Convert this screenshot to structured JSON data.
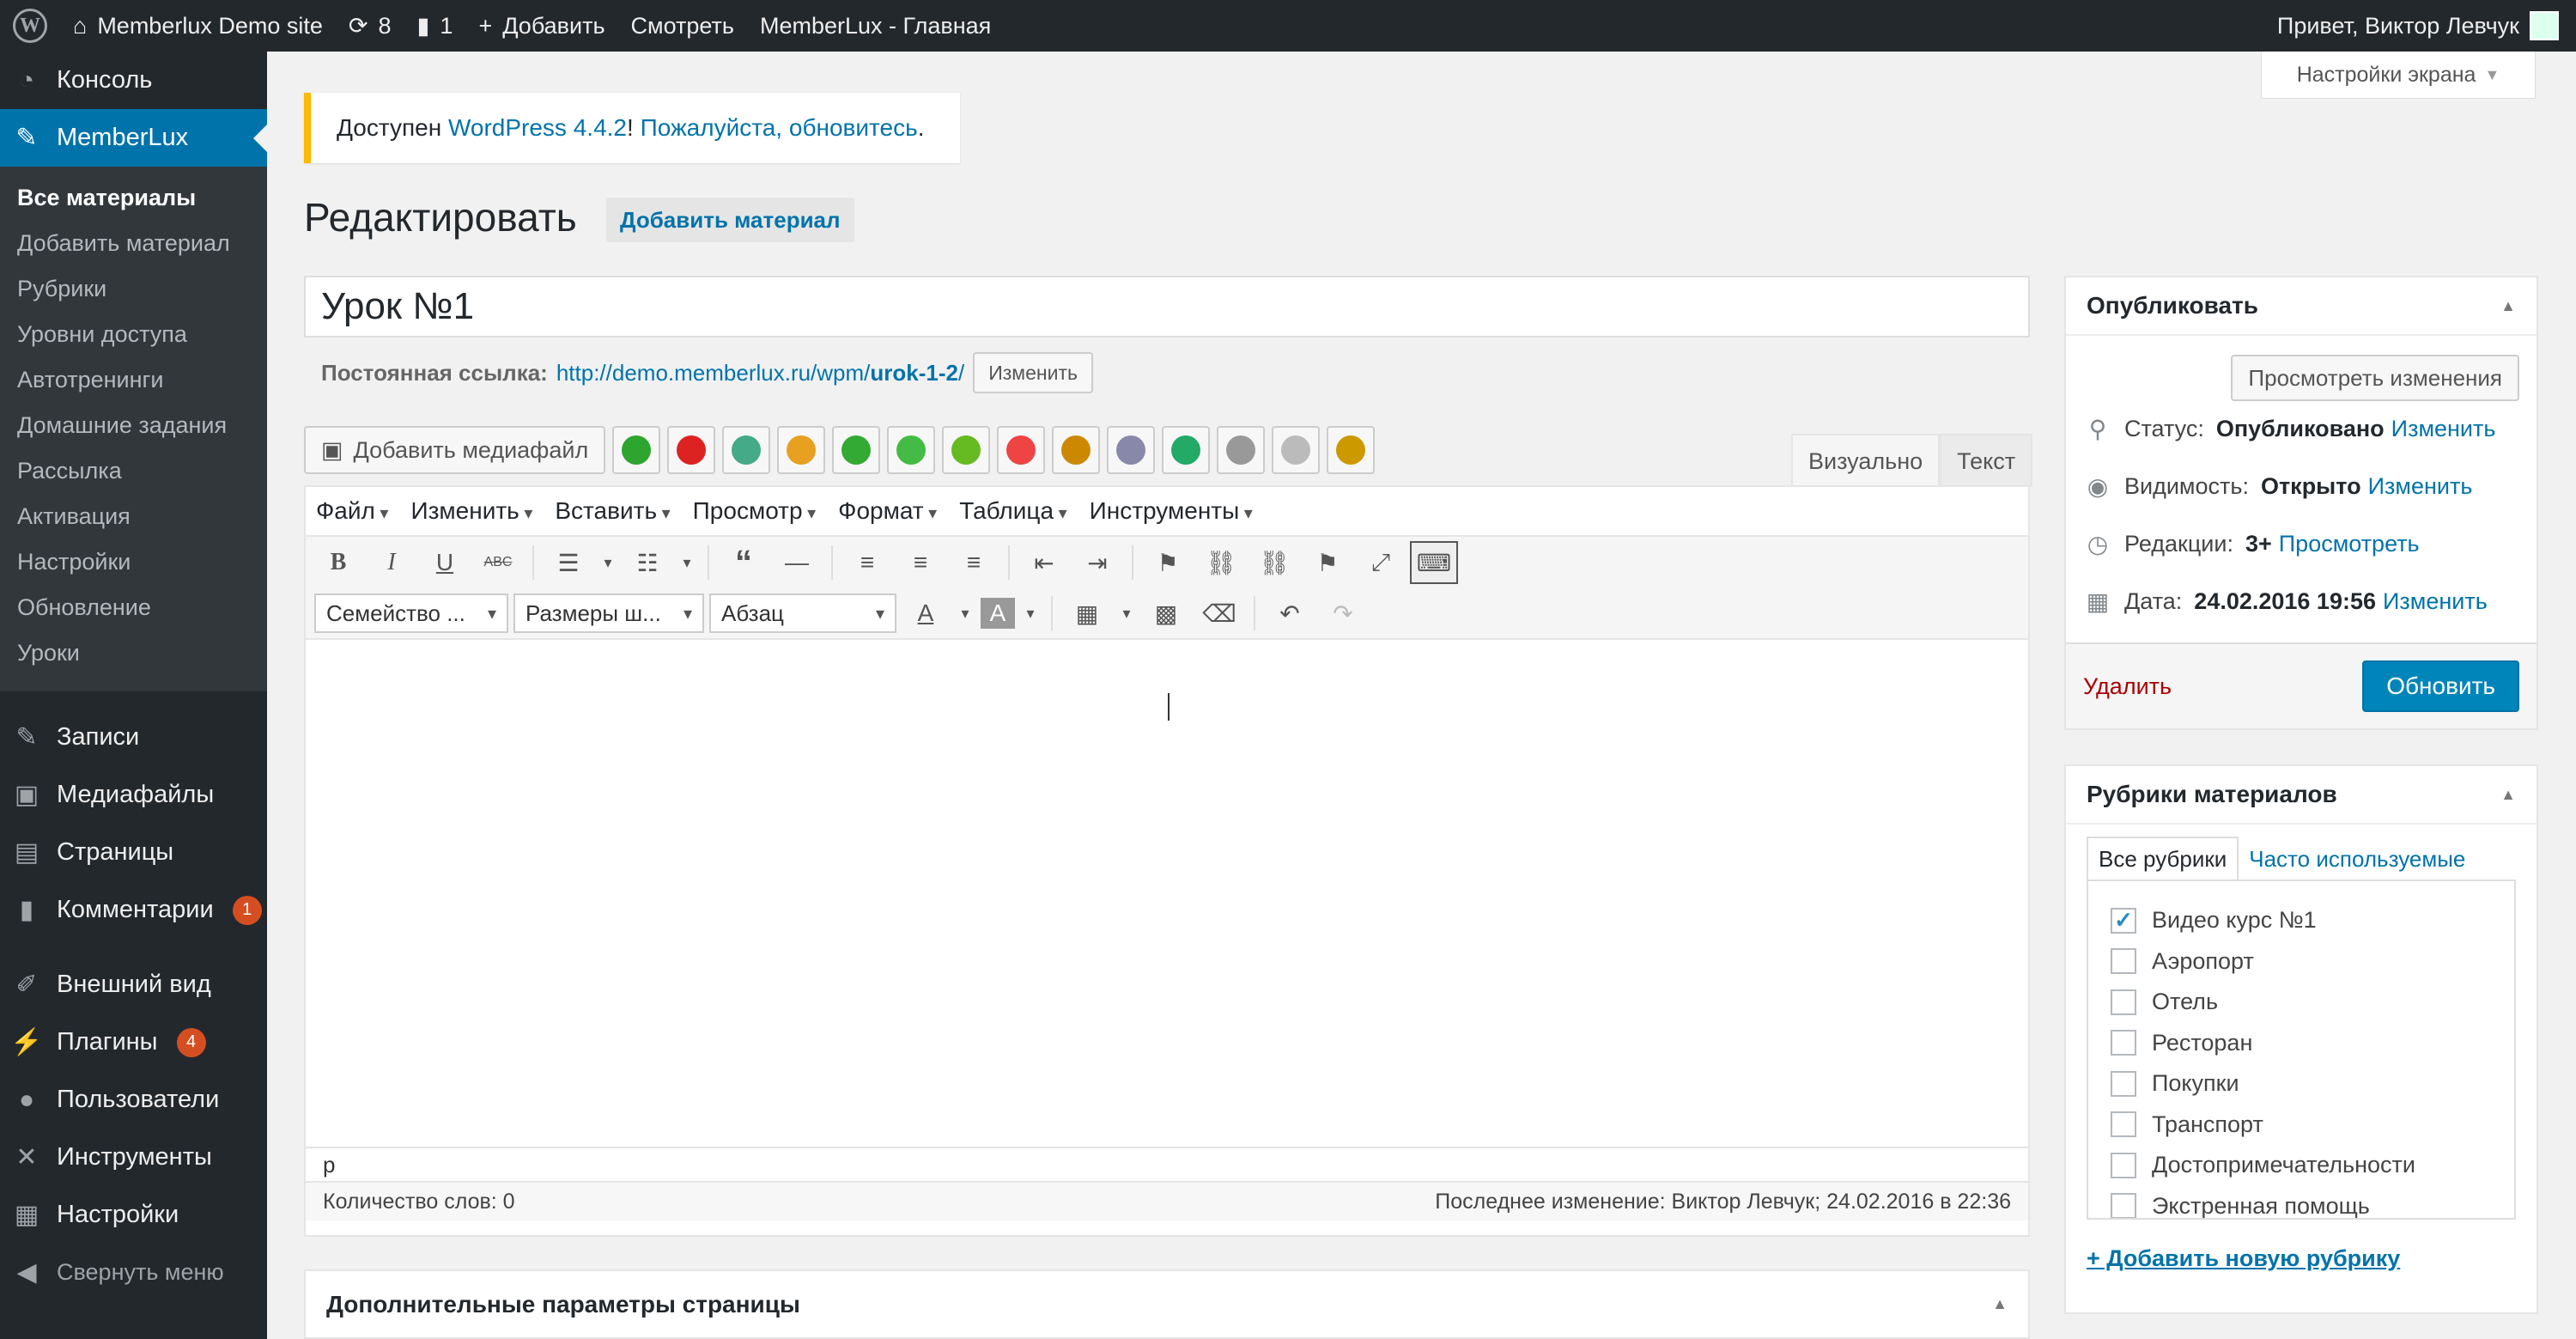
{
  "adminbar": {
    "site_name": "Memberlux Demo site",
    "updates_count": "8",
    "comments_count": "1",
    "new_label": "Добавить",
    "view_label": "Смотреть",
    "home_label": "MemberLux - Главная",
    "greeting": "Привет, Виктор Левчук"
  },
  "sidebar": {
    "top": [
      {
        "label": "Консоль",
        "icon": "dashboard-icon"
      },
      {
        "label": "MemberLux",
        "icon": "pin-icon"
      }
    ],
    "submenu": [
      "Все материалы",
      "Добавить материал",
      "Рубрики",
      "Уровни доступа",
      "Автотренинги",
      "Домашние задания",
      "Рассылка",
      "Активация",
      "Настройки",
      "Обновление",
      "Уроки"
    ],
    "group2": [
      {
        "label": "Записи",
        "icon": "pin-icon"
      },
      {
        "label": "Медиафайлы",
        "icon": "media-icon"
      },
      {
        "label": "Страницы",
        "icon": "pages-icon"
      },
      {
        "label": "Комментарии",
        "icon": "comments-icon",
        "badge": "1"
      }
    ],
    "group3": [
      {
        "label": "Внешний вид",
        "icon": "brush-icon"
      },
      {
        "label": "Плагины",
        "icon": "plugin-icon",
        "badge": "4"
      },
      {
        "label": "Пользователи",
        "icon": "users-icon"
      },
      {
        "label": "Инструменты",
        "icon": "tools-icon"
      },
      {
        "label": "Настройки",
        "icon": "settings-icon"
      }
    ],
    "collapse": "Свернуть меню"
  },
  "notice": {
    "prefix": "Доступен ",
    "link1": "WordPress 4.4.2",
    "middle": "! ",
    "link2": "Пожалуйста, обновитесь",
    "suffix": "."
  },
  "screen_options": "Настройки экрана",
  "page": {
    "title": "Редактировать",
    "add_button": "Добавить материал",
    "post_title": "Урок №1",
    "permalink_label": "Постоянная ссылка:",
    "permalink_base": "http://demo.memberlux.ru/wpm/",
    "permalink_slug": "urok-1-2",
    "permalink_end": "/",
    "permalink_edit": "Изменить"
  },
  "editor": {
    "add_media": "Добавить медиафайл",
    "tab_visual": "Визуально",
    "tab_text": "Текст",
    "menus": [
      "Файл",
      "Изменить",
      "Вставить",
      "Просмотр",
      "Формат",
      "Таблица",
      "Инструменты"
    ],
    "font_family": "Семейство ...",
    "font_size": "Размеры ш...",
    "format": "Абзац",
    "path": "p",
    "word_count": "Количество слов: 0",
    "last_edit": "Последнее изменение: Виктор Левчук; 24.02.2016 в 22:36",
    "plugin_colors": [
      "#2ea52e",
      "#d22",
      "#4a8",
      "#e8a020",
      "#3a3",
      "#4b4",
      "#6b2",
      "#e44",
      "#c80",
      "#88a",
      "#2a6",
      "#999",
      "#bbb",
      "#c90"
    ]
  },
  "extra_box": {
    "title": "Дополнительные параметры страницы"
  },
  "publish": {
    "title": "Опубликовать",
    "preview": "Просмотреть изменения",
    "status_label": "Статус:",
    "status_value": "Опубликовано",
    "status_link": "Изменить",
    "visibility_label": "Видимость:",
    "visibility_value": "Открыто",
    "visibility_link": "Изменить",
    "revisions_label": "Редакции:",
    "revisions_value": "3+",
    "revisions_link": "Просмотреть",
    "date_label": "Дата:",
    "date_value": "24.02.2016 19:56",
    "date_link": "Изменить",
    "delete": "Удалить",
    "update": "Обновить"
  },
  "categories": {
    "title": "Рубрики материалов",
    "tab_all": "Все рубрики",
    "tab_popular": "Часто используемые",
    "items": [
      {
        "label": "Видео курс №1",
        "checked": true
      },
      {
        "label": "Аэропорт",
        "checked": false
      },
      {
        "label": "Отель",
        "checked": false
      },
      {
        "label": "Ресторан",
        "checked": false
      },
      {
        "label": "Покупки",
        "checked": false
      },
      {
        "label": "Транспорт",
        "checked": false
      },
      {
        "label": "Достопримечательности",
        "checked": false
      },
      {
        "label": "Экстренная помощь",
        "checked": false
      }
    ],
    "add_new": "+ Добавить новую рубрику"
  }
}
